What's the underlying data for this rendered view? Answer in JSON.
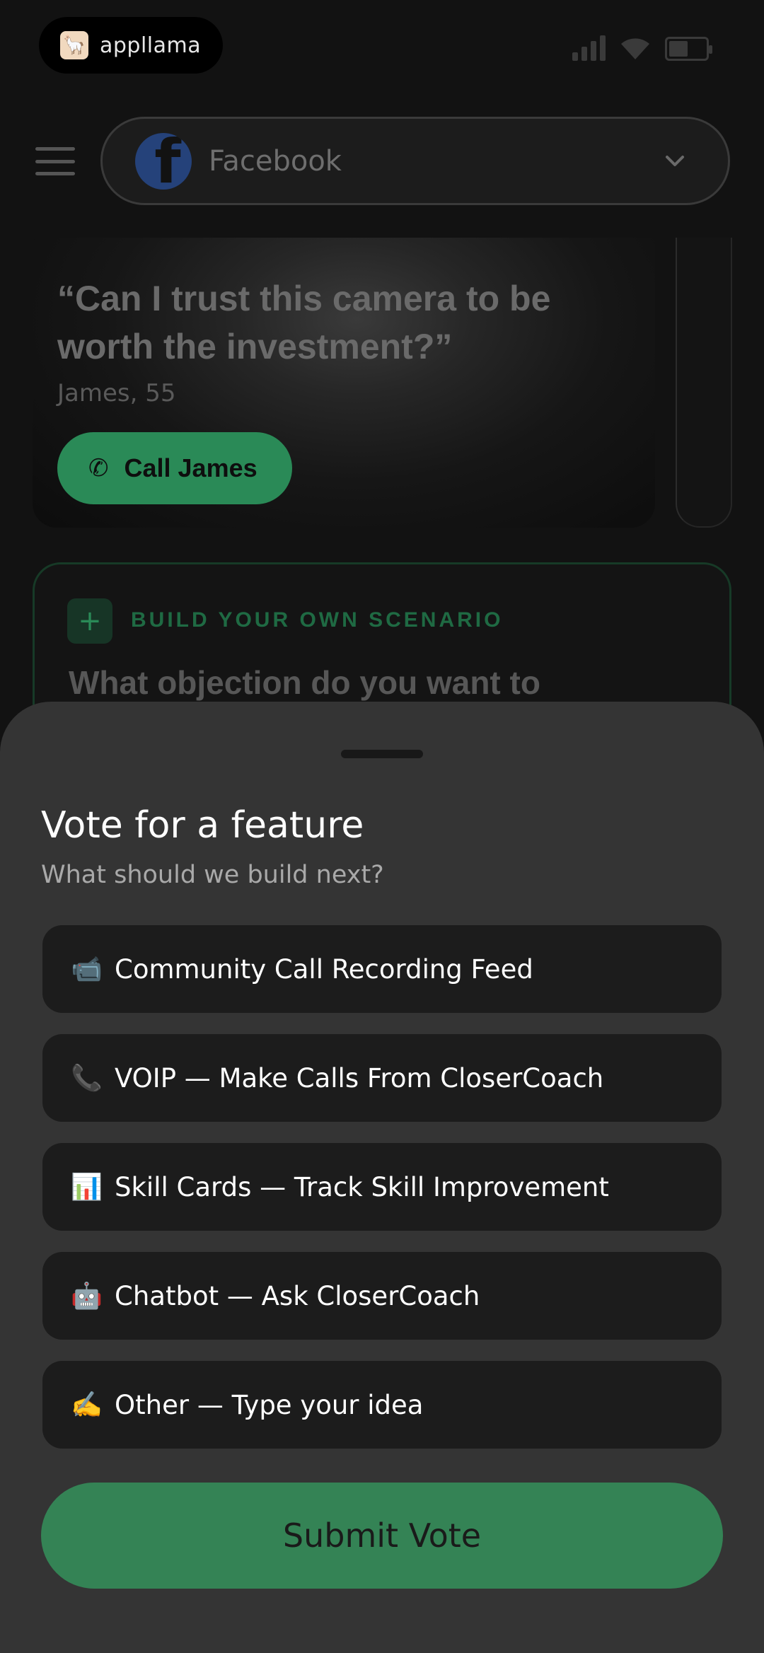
{
  "status_bar": {
    "brand": "appllama",
    "brand_icon": "llama-logo-icon",
    "icons": [
      "signal-icon",
      "wifi-icon",
      "battery-icon"
    ]
  },
  "header": {
    "menu_icon": "hamburger-menu-icon",
    "platform": {
      "label": "Facebook",
      "icon": "facebook-icon",
      "chevron": "chevron-down-icon"
    }
  },
  "scenario": {
    "quote": "“Can I trust this camera to be worth the investment?”",
    "person": "James, 55",
    "call_button": "Call James",
    "call_icon": "phone-icon"
  },
  "build_card": {
    "label": "BUILD YOUR OWN SCENARIO",
    "question": "What objection do you want to"
  },
  "sheet": {
    "title": "Vote for a feature",
    "subtitle": "What should we build next?",
    "options": [
      {
        "emoji": "📹",
        "label": "Community Call Recording Feed"
      },
      {
        "emoji": "📞",
        "label": "VOIP — Make Calls From CloserCoach"
      },
      {
        "emoji": "📊",
        "label": "Skill Cards — Track Skill Improvement"
      },
      {
        "emoji": "🤖",
        "label": "Chatbot — Ask CloserCoach"
      },
      {
        "emoji": "✍️",
        "label": "Other — Type your idea"
      }
    ],
    "submit": "Submit Vote"
  },
  "colors": {
    "accent_green": "#348355",
    "sheet_bg": "#343434",
    "option_bg": "#1c1c1c"
  }
}
